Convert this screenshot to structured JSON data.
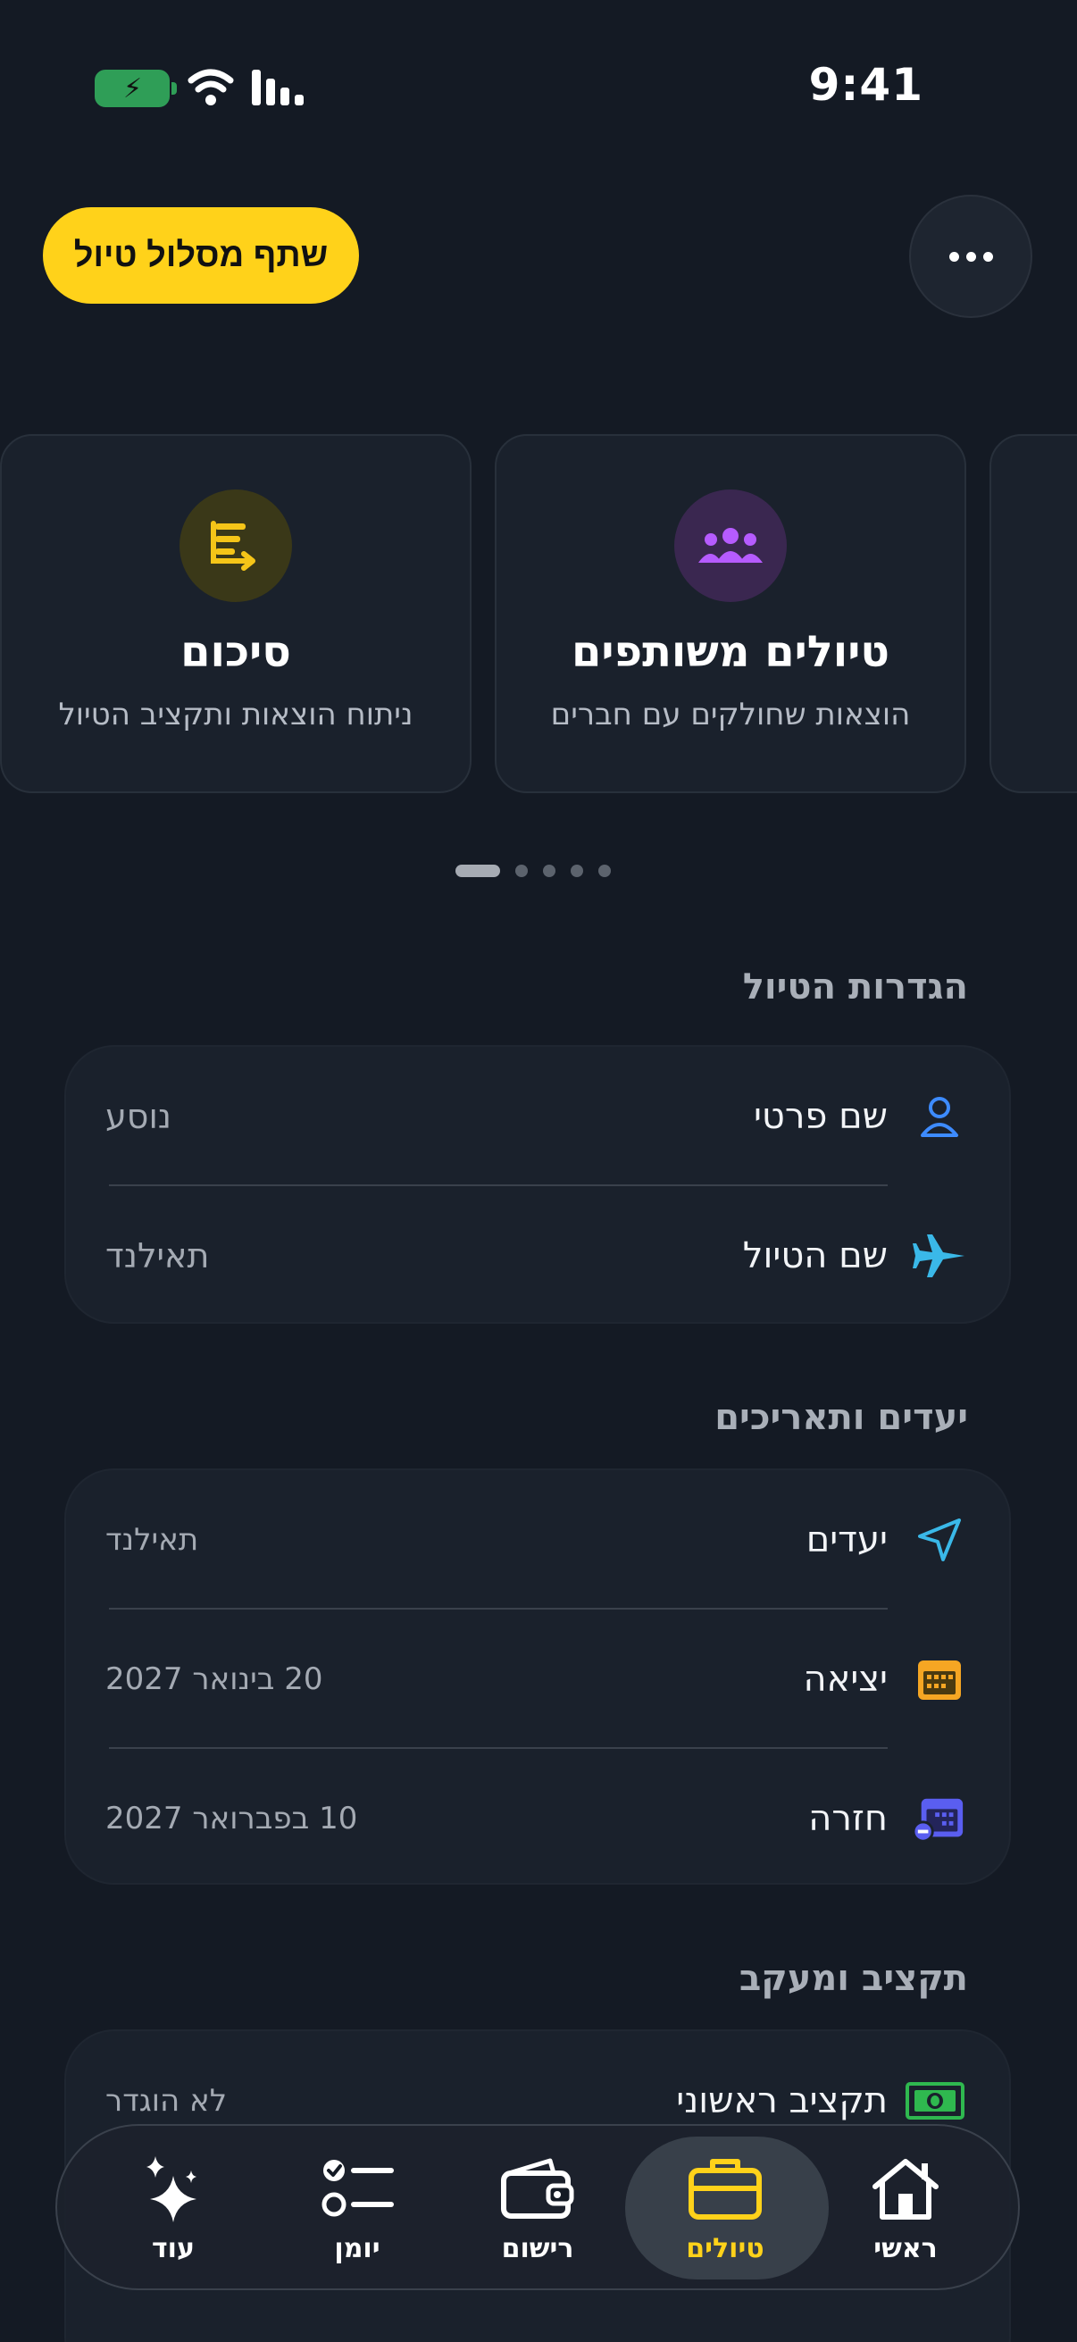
{
  "status_bar": {
    "time": "9:41"
  },
  "header": {
    "share_button": "שתף מסלול טיול"
  },
  "carousel": {
    "cards": [
      {
        "title": "סיכום",
        "subtitle": "ניתוח הוצאות ותקציב הטיול",
        "icon": "summary-list-icon",
        "color": "#f5c518"
      },
      {
        "title": "טיולים משותפים",
        "subtitle": "הוצאות שחולקים עם חברים",
        "icon": "group-people-icon",
        "color": "#b65bff"
      }
    ],
    "page_count": 5,
    "active_page": 1
  },
  "trip_settings": {
    "title": "הגדרות הטיול",
    "rows": [
      {
        "label": "שם פרטי",
        "value": "נוסע",
        "icon": "person-icon"
      },
      {
        "label": "שם הטיול",
        "value": "תאילנד",
        "icon": "airplane-icon"
      }
    ]
  },
  "destinations": {
    "title": "יעדים ותאריכים",
    "rows": [
      {
        "label": "יעדים",
        "value": "תאילנד",
        "icon": "navigation-arrow-icon"
      },
      {
        "label": "יציאה",
        "value": "20 בינואר 2027",
        "icon": "calendar-icon"
      },
      {
        "label": "חזרה",
        "value": "10 בפברואר 2027",
        "icon": "calendar-minus-icon"
      }
    ]
  },
  "budget": {
    "title": "תקציב ומעקב",
    "rows": [
      {
        "label": "תקציב ראשוני",
        "value": "לא הוגדר",
        "icon": "banknote-icon"
      }
    ]
  },
  "tabbar": {
    "tabs": [
      {
        "label": "ראשי",
        "icon": "home-icon"
      },
      {
        "label": "טיולים",
        "icon": "suitcase-icon",
        "active": true
      },
      {
        "label": "רישום",
        "icon": "wallet-icon"
      },
      {
        "label": "יומן",
        "icon": "checklist-icon"
      },
      {
        "label": "עוד",
        "icon": "sparkles-icon"
      }
    ]
  },
  "colors": {
    "accent": "#ffd21a",
    "background": "#141a24",
    "panel": "#1a212c"
  }
}
